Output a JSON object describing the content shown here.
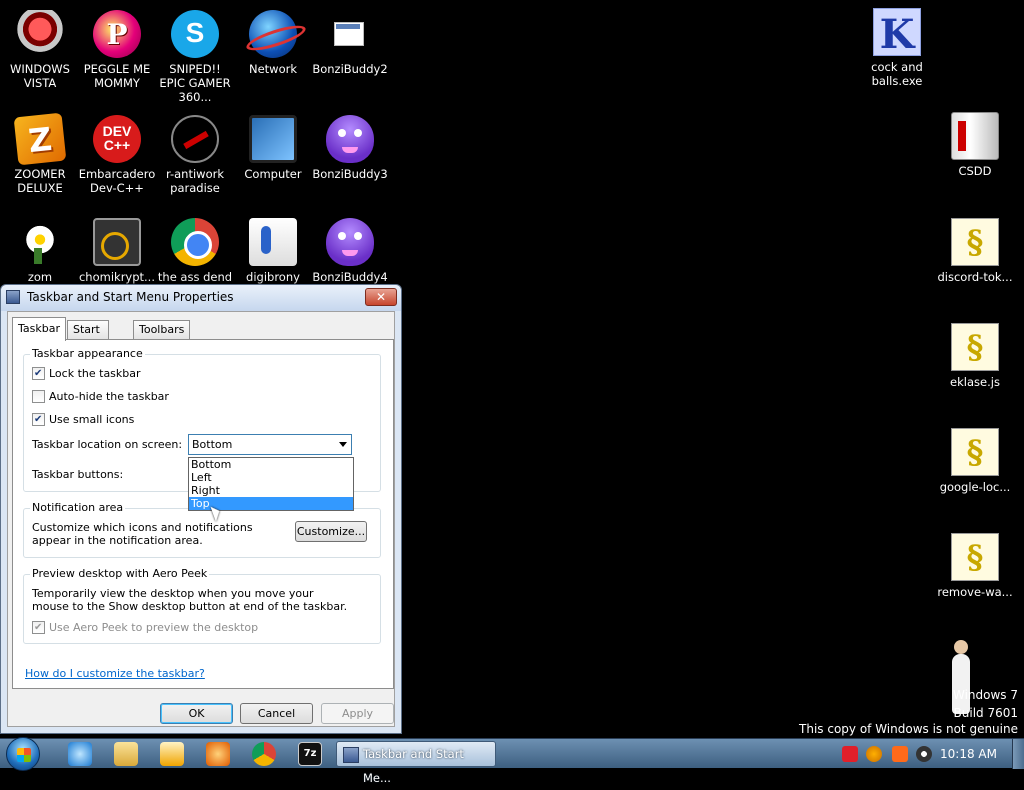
{
  "desktop": {
    "icons": [
      {
        "label": "WINDOWS VISTA"
      },
      {
        "label": "PEGGLE ME MOMMY"
      },
      {
        "label": "SNIPED!! EPIC GAMER 360..."
      },
      {
        "label": "Network"
      },
      {
        "label": "BonziBuddy2"
      },
      {
        "label": "ZOOMER DELUXE"
      },
      {
        "label": "Embarcadero Dev-C++"
      },
      {
        "label": "r-antiwork paradise"
      },
      {
        "label": "Computer"
      },
      {
        "label": "BonziBuddy3"
      },
      {
        "label": "zom"
      },
      {
        "label": "chomikrypt..."
      },
      {
        "label": "the ass dend"
      },
      {
        "label": "digibrony"
      },
      {
        "label": "BonziBuddy4"
      },
      {
        "label": "cock and balls.exe"
      },
      {
        "label": "CSDD"
      },
      {
        "label": "discord-tok..."
      },
      {
        "label": "eklase.js"
      },
      {
        "label": "google-loc..."
      },
      {
        "label": "remove-wa..."
      }
    ],
    "icon_glyphs": {
      "peggle": "P",
      "skype": "S",
      "zoomer": "Z",
      "dev": "DEV C++",
      "k": "K",
      "script": "§"
    }
  },
  "watermark": {
    "line1": "Windows 7",
    "line2": "Build 7601",
    "line3": "This copy of Windows is not genuine"
  },
  "dialog": {
    "title": "Taskbar and Start Menu Properties",
    "close_label": "✕",
    "tabs": [
      "Taskbar",
      "Start Menu",
      "Toolbars"
    ],
    "active_tab": "Taskbar",
    "appearance": {
      "title": "Taskbar appearance",
      "lock": {
        "label": "Lock the taskbar",
        "checked": true
      },
      "autohide": {
        "label": "Auto-hide the taskbar",
        "checked": false
      },
      "small_icons": {
        "label": "Use small icons",
        "checked": true
      },
      "location_label": "Taskbar location on screen:",
      "location_value": "Bottom",
      "location_options": [
        "Bottom",
        "Left",
        "Right",
        "Top"
      ],
      "location_highlighted": "Top",
      "buttons_label": "Taskbar buttons:"
    },
    "notification": {
      "title": "Notification area",
      "text": "Customize which icons and notifications appear in the notification area.",
      "button": "Customize..."
    },
    "peek": {
      "title": "Preview desktop with Aero Peek",
      "text": "Temporarily view the desktop when you move your mouse to the Show desktop button at end of the taskbar.",
      "checkbox": {
        "label": "Use Aero Peek to preview the desktop",
        "checked": true,
        "disabled": true
      }
    },
    "help_link": "How do I customize the taskbar?",
    "buttons": {
      "ok": "OK",
      "cancel": "Cancel",
      "apply": "Apply"
    }
  },
  "taskbar": {
    "active_task": "Taskbar and Start Me...",
    "clock": "10:18 AM",
    "pinned": [
      "internet-explorer",
      "windows-explorer",
      "media-player",
      "paint-app",
      "chrome",
      "7zip"
    ],
    "pinned_glyphs": {
      "7zip": "7z"
    },
    "tray": [
      "vivaldi",
      "search",
      "app-orange",
      "obs"
    ]
  },
  "colors": {
    "desktop_bg": "#000000",
    "taskbar": "#4a6c8f",
    "highlight": "#3399ff",
    "link": "#0066cc"
  }
}
